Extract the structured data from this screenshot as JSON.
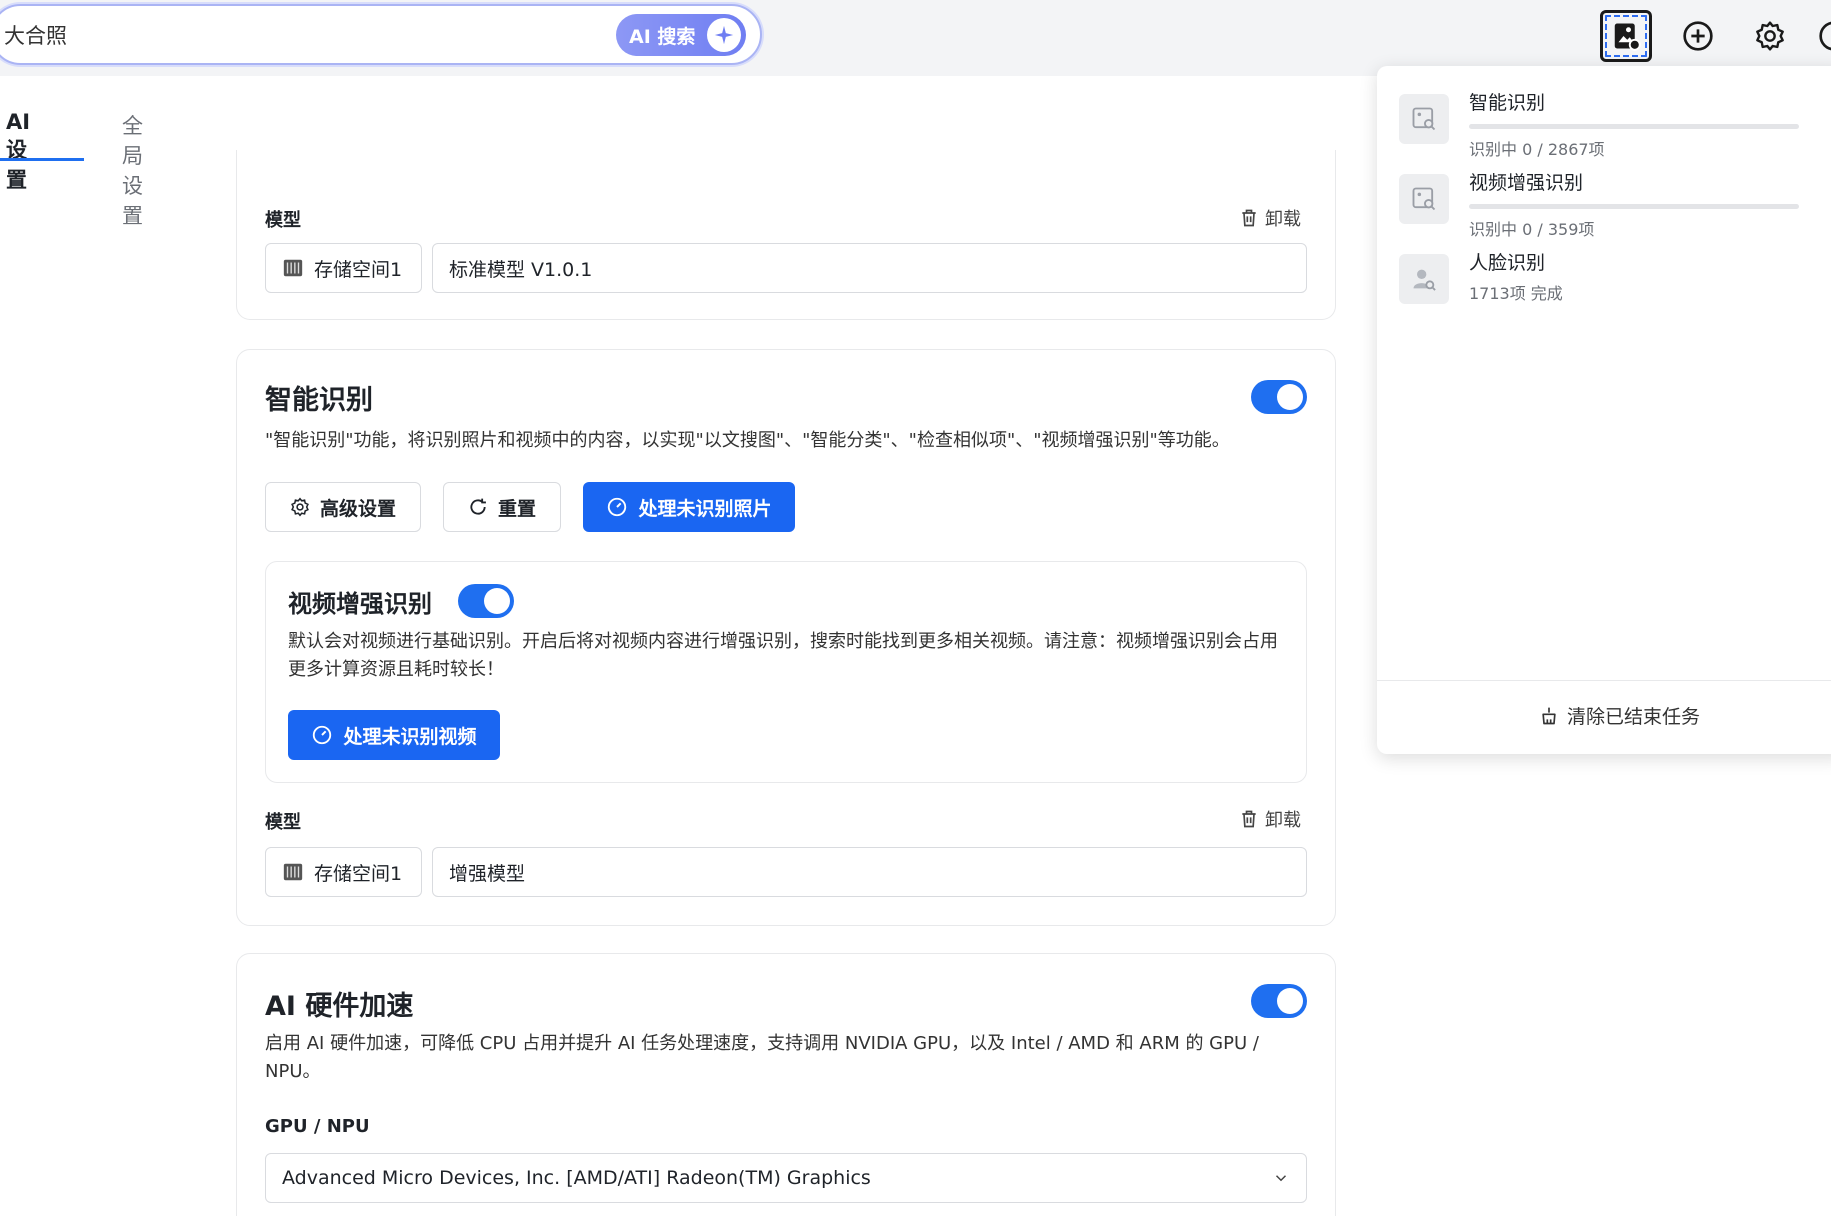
{
  "search": {
    "value": "大合照",
    "placeholder": "大合照",
    "ai_label": "AI 搜索"
  },
  "tabs": [
    {
      "label": "AI 设置"
    },
    {
      "label": "全局设置"
    }
  ],
  "model_section_top": {
    "label": "模型",
    "unload_label": "卸载",
    "storage": "存储空间1",
    "model": "标准模型 V1.0.1"
  },
  "smart_recognition": {
    "title": "智能识别",
    "desc": "\"智能识别\"功能，将识别照片和视频中的内容，以实现\"以文搜图\"、\"智能分类\"、\"检查相似项\"、\"视频增强识别\"等功能。",
    "advanced_label": "高级设置",
    "reset_label": "重置",
    "process_photos_label": "处理未识别照片",
    "video": {
      "title": "视频增强识别",
      "desc": "默认会对视频进行基础识别。开启后将对视频内容进行增强识别，搜索时能找到更多相关视频。请注意：视频增强识别会占用更多计算资源且耗时较长！",
      "process_label": "处理未识别视频"
    },
    "model_label": "模型",
    "unload_label": "卸载",
    "storage": "存储空间1",
    "model": "增强模型"
  },
  "hardware": {
    "title": "AI 硬件加速",
    "desc": "启用 AI 硬件加速，可降低 CPU 占用并提升 AI 任务处理速度，支持调用 NVIDIA GPU，以及 Intel / AMD 和 ARM 的 GPU / NPU。",
    "gpu_label": "GPU / NPU",
    "gpu_selected": "Advanced Micro Devices, Inc. [AMD/ATI] Radeon(TM) Graphics"
  },
  "tasks": [
    {
      "name": "智能识别",
      "status": "识别中 0 / 2867项",
      "progress": 0,
      "icon": "image-search-icon"
    },
    {
      "name": "视频增强识别",
      "status": "识别中 0 / 359项",
      "progress": 0,
      "icon": "image-search-icon"
    },
    {
      "name": "人脸识别",
      "status": "1713项 完成",
      "progress": 1,
      "icon": "person-search-icon"
    }
  ],
  "panel": {
    "clear_label": "清除已结束任务"
  },
  "colors": {
    "accent": "#1a66f2",
    "ai_gradient_start": "#8d98f5",
    "ai_gradient_end": "#6f7ef2"
  }
}
